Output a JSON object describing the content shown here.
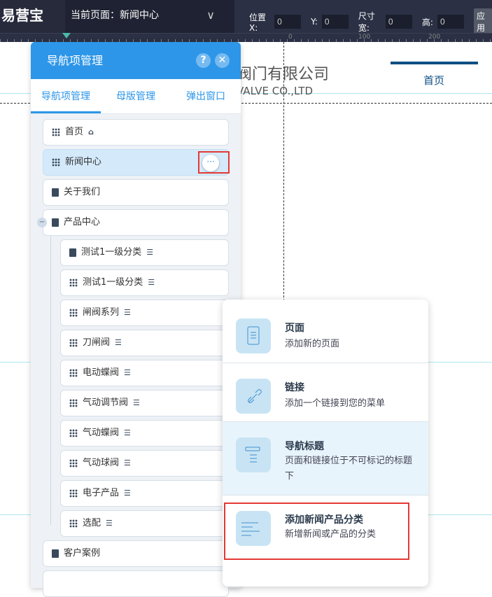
{
  "topbar": {
    "logo": "易营宝",
    "current_page_label": "当前页面：新闻中心",
    "pos_x_label": "位置 X:",
    "pos_x": "0",
    "pos_y_label": "Y:",
    "pos_y": "0",
    "width_label": "尺寸 宽:",
    "width": "0",
    "height_label": "高:",
    "height": "0",
    "apply": "应用"
  },
  "ruler": {
    "ticks": [
      "0",
      "100",
      "200"
    ]
  },
  "canvas": {
    "company_cn": "阀门有限公司",
    "company_en": "VALVE CO.,LTD",
    "nav_home": "首页"
  },
  "panel": {
    "title": "导航项管理",
    "help": "?",
    "close": "✕",
    "tabs": [
      "导航项管理",
      "母版管理",
      "弹出窗口"
    ],
    "items": [
      {
        "label": "首页",
        "icon": "grid"
      },
      {
        "label": "新闻中心",
        "icon": "grid"
      },
      {
        "label": "关于我们",
        "icon": "doc"
      },
      {
        "label": "产品中心",
        "icon": "doc"
      }
    ],
    "children": [
      {
        "label": "测试1一级分类",
        "icon": "doc"
      },
      {
        "label": "测试1一级分类",
        "icon": "grid"
      },
      {
        "label": "闸阀系列",
        "icon": "grid"
      },
      {
        "label": "刀闸阀",
        "icon": "grid"
      },
      {
        "label": "电动蝶阀",
        "icon": "grid"
      },
      {
        "label": "气动调节阀",
        "icon": "grid"
      },
      {
        "label": "气动蝶阀",
        "icon": "grid"
      },
      {
        "label": "气动球阀",
        "icon": "grid"
      },
      {
        "label": "电子产品",
        "icon": "grid"
      },
      {
        "label": "选配",
        "icon": "grid"
      }
    ],
    "after": [
      {
        "label": "客户案例",
        "icon": "doc"
      }
    ],
    "more": "···"
  },
  "popup": [
    {
      "title": "页面",
      "desc": "添加新的页面",
      "icon": "page-icon"
    },
    {
      "title": "链接",
      "desc": "添加一个链接到您的菜单",
      "icon": "link-icon"
    },
    {
      "title": "导航标题",
      "desc": "页面和链接位于不可标记的标题下",
      "icon": "nav-title-icon"
    },
    {
      "title": "添加新闻产品分类",
      "desc": "新增新闻或产品的分类",
      "icon": "category-icon"
    }
  ],
  "colors": {
    "accent": "#2d96e8",
    "highlight": "#e53935"
  }
}
